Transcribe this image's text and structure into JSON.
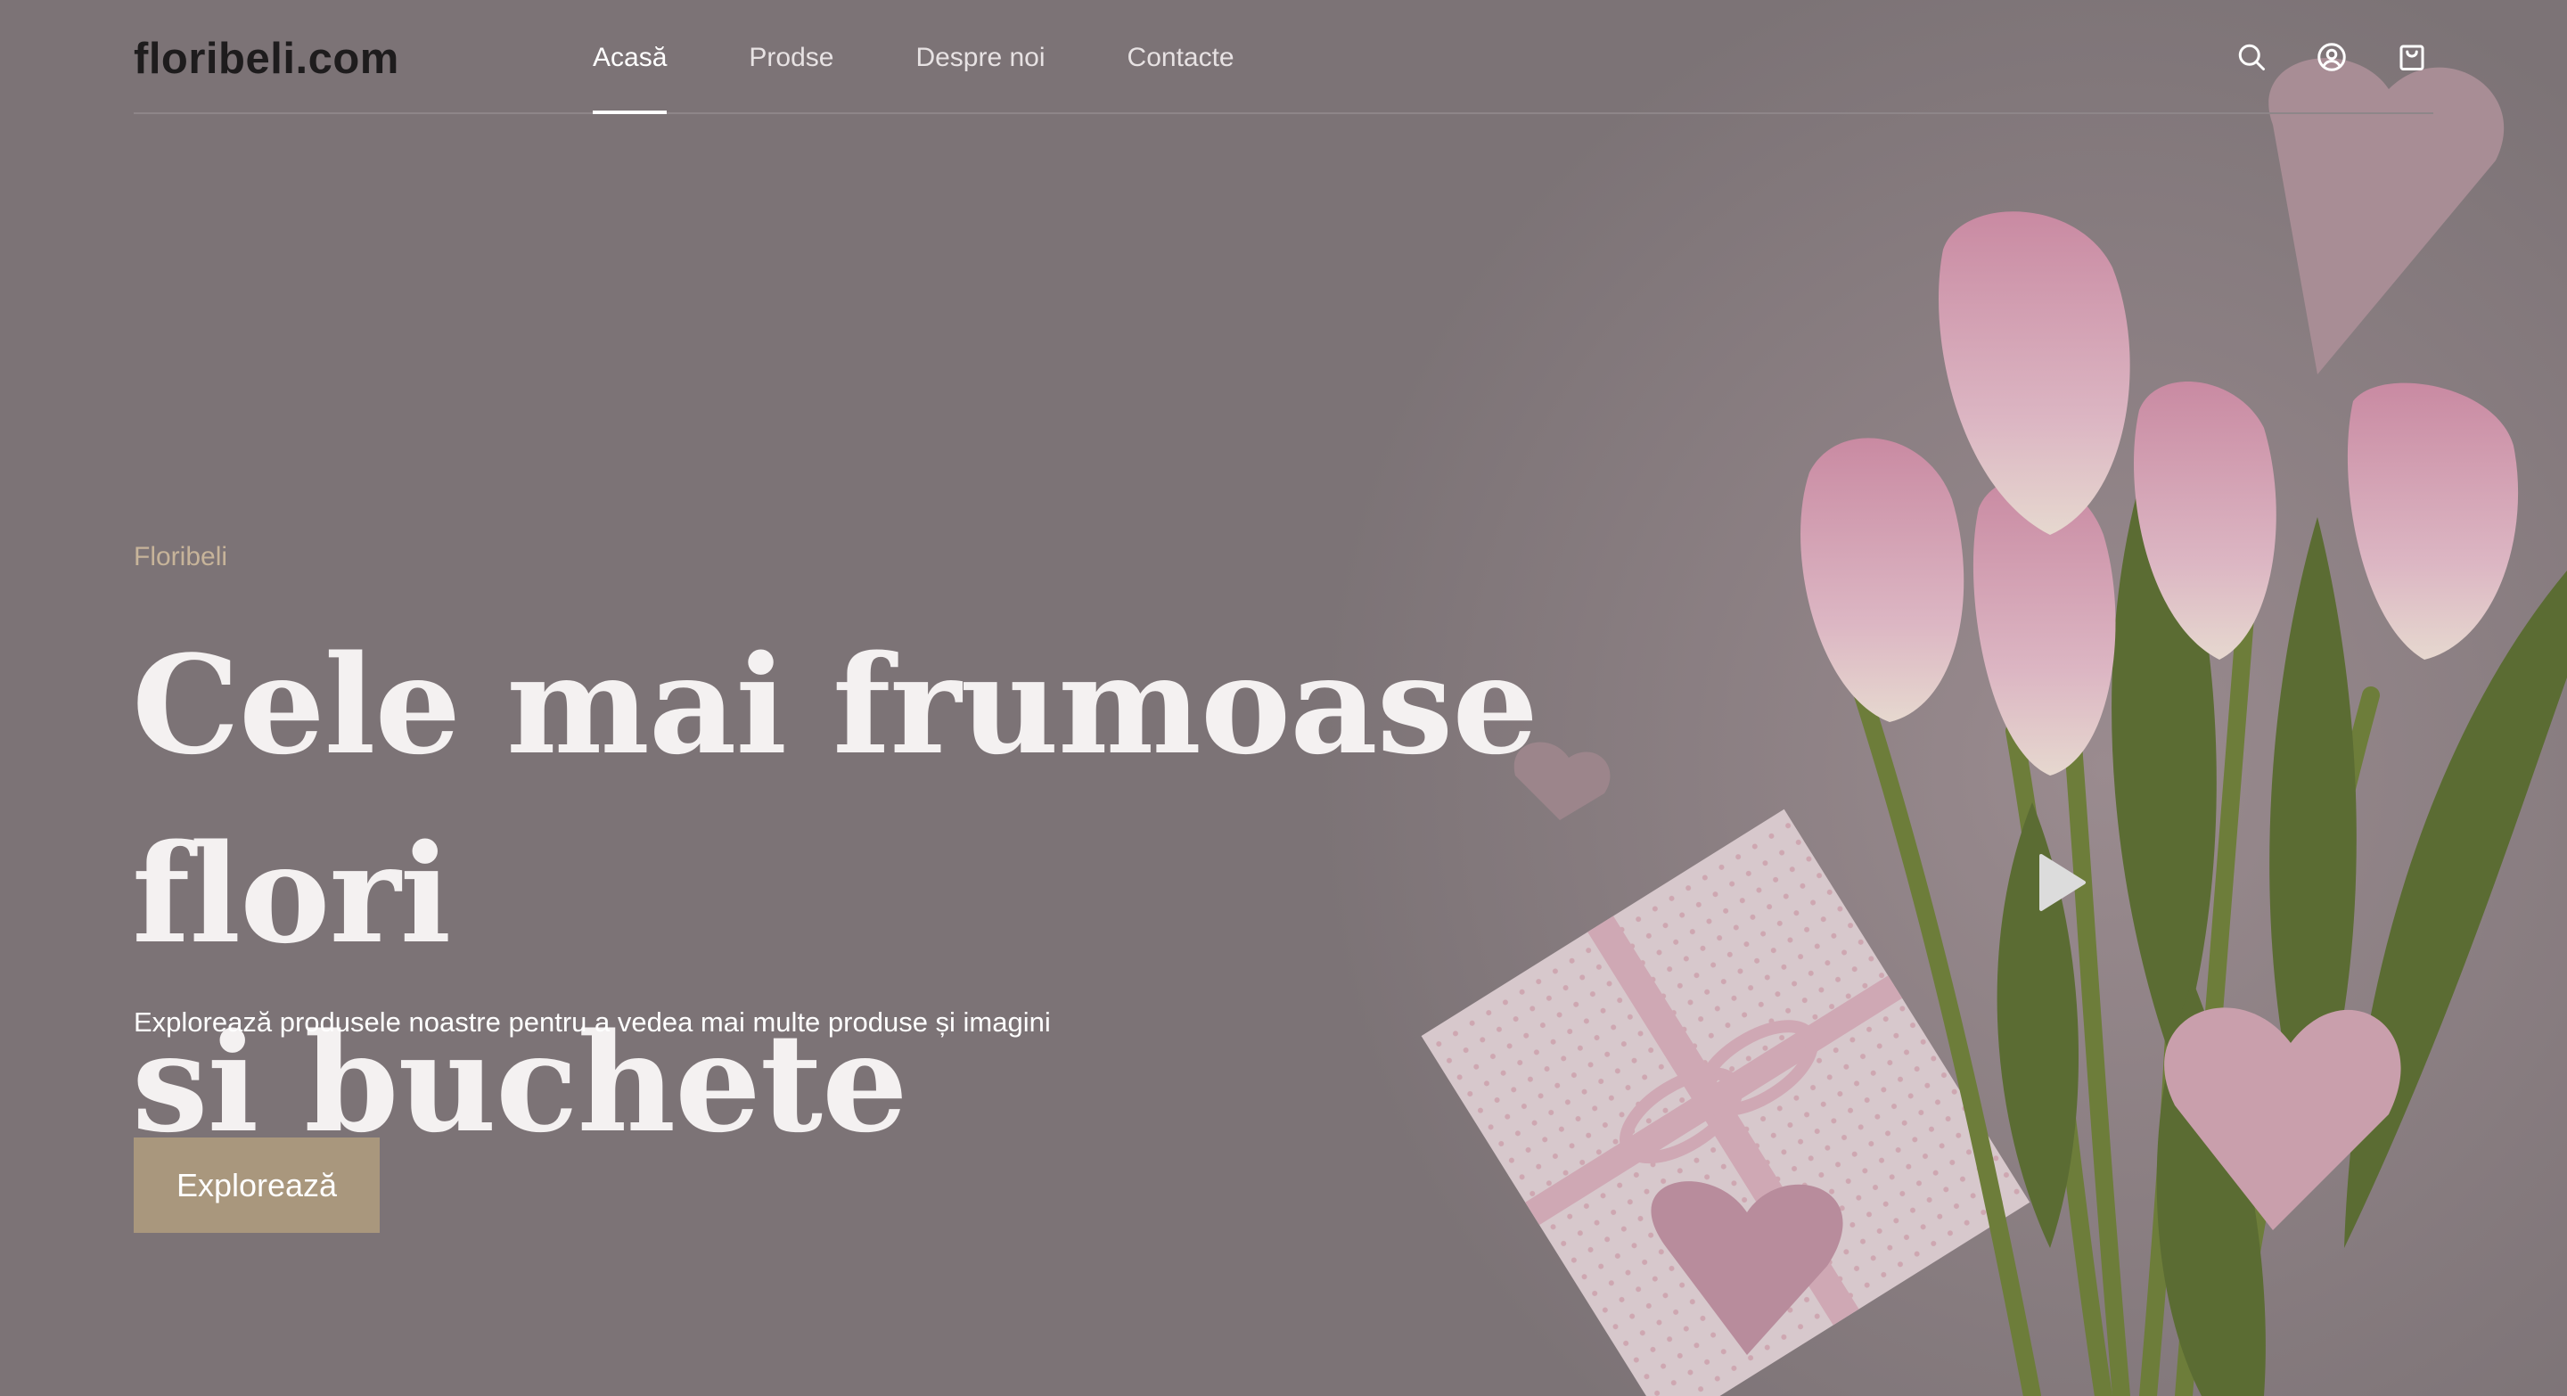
{
  "header": {
    "logo": "floribeli.com",
    "nav": [
      {
        "label": "Acasă",
        "active": true
      },
      {
        "label": "Prodse",
        "active": false
      },
      {
        "label": "Despre noi",
        "active": false
      },
      {
        "label": "Contacte",
        "active": false
      }
    ],
    "icons": [
      "search-icon",
      "account-icon",
      "cart-icon"
    ]
  },
  "hero": {
    "eyebrow": "Floribeli",
    "headline_line1": "Cele mai frumoase flori",
    "headline_line2": "și buchete",
    "subtitle": "Explorează produsele noastre pentru a vedea mai multe produse și imagini",
    "cta_label": "Explorează",
    "play_icon": "play-icon",
    "image_subject": "tulips-gift-hearts"
  },
  "colors": {
    "overlay_bg": "#7c7376",
    "accent": "#a9977d",
    "eyebrow": "#c7b49a",
    "text_light": "#f4f1f1"
  }
}
